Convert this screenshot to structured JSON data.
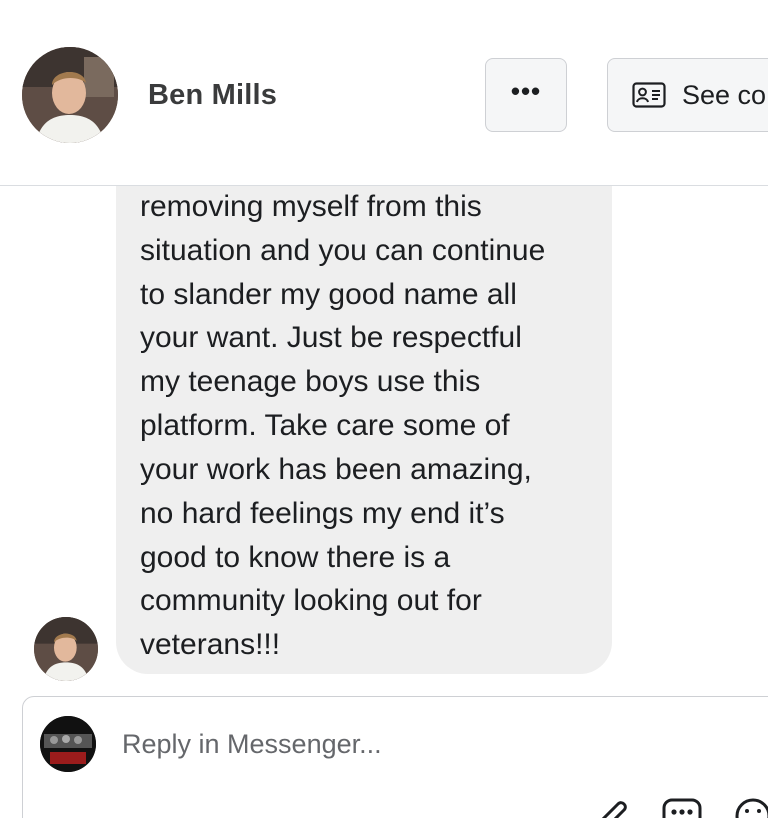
{
  "header": {
    "name": "Ben Mills",
    "more_button_label": "•••",
    "see_button_label": "See co"
  },
  "message": {
    "lines": [
      "removing myself from this",
      "situation and you can continue",
      "to slander my good name all",
      "your want. Just be respectful",
      "my teenage boys use this",
      "platform. Take care some of",
      "your work has been amazing,",
      "no hard feelings my end it’s",
      "good to know there is a",
      "community looking out for",
      "veterans!!!"
    ]
  },
  "reply": {
    "placeholder": "Reply in Messenger..."
  },
  "icons": {
    "more": "ellipsis-icon",
    "contact": "contact-card-icon",
    "attach": "paperclip-icon",
    "chat": "chat-bubble-icon",
    "emoji": "emoji-icon"
  }
}
